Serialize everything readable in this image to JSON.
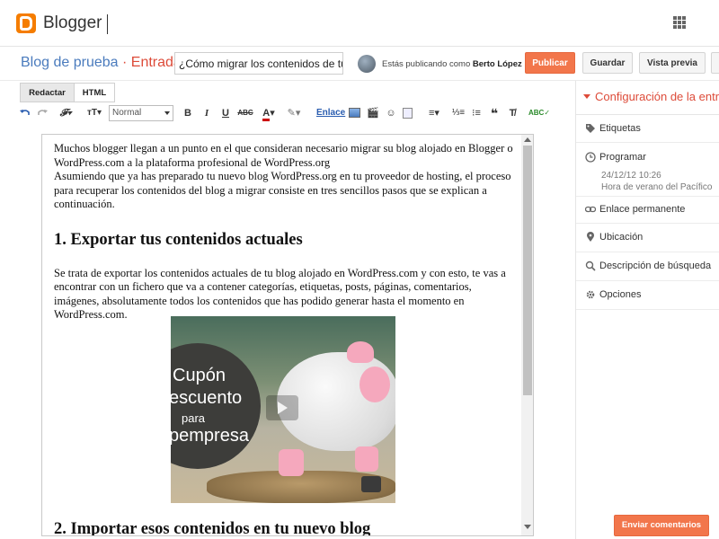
{
  "app": {
    "name": "Blogger"
  },
  "header": {
    "blog_name": "Blog de prueba",
    "separator": "·",
    "entry_label": "Entrada",
    "post_title": "¿Cómo migrar los contenidos de tu blog",
    "publishing_prefix": "Estás publicando como",
    "publishing_user": "Berto López",
    "publish_label": "Publicar",
    "save_label": "Guardar",
    "preview_label": "Vista previa"
  },
  "editor": {
    "tabs": [
      "Redactar",
      "HTML"
    ],
    "font_size": "Normal",
    "link_label": "Enlace",
    "paragraphs": [
      "Muchos blogger llegan a un punto en el que consideran necesario migrar su blog alojado en Blogger o WordPress.com a la plataforma profesional de WordPress.org",
      "Asumiendo que ya has preparado tu nuevo blog WordPress.org en tu proveedor de hosting, el proceso para recuperar los contenidos del blog a migrar consiste en tres sencillos pasos que se explican a continuación.",
      "Se trata de exportar los contenidos actuales de tu blog alojado en WordPress.com y con esto, te vas a encontrar con un fichero que va a contener categorías, etiquetas, posts, páginas, comentarios, imágenes, absolutamente todos los contenidos que has podido generar hasta el momento en WordPress.com."
    ],
    "headings": [
      "1. Exportar tus contenidos actuales",
      "2. Importar esos contenidos en tu nuevo blog"
    ],
    "video_text": [
      "Cupón",
      "escuento",
      "para",
      "pempresa"
    ]
  },
  "sidebar": {
    "title": "Configuración de la entrada",
    "items": [
      {
        "label": "Etiquetas",
        "icon": "tag-icon"
      },
      {
        "label": "Programar",
        "icon": "clock-icon",
        "sub": [
          "24/12/12 10:26",
          "Hora de verano del Pacífico"
        ]
      },
      {
        "label": "Enlace permanente",
        "icon": "link-icon"
      },
      {
        "label": "Ubicación",
        "icon": "location-icon"
      },
      {
        "label": "Descripción de búsqueda",
        "icon": "search-icon"
      },
      {
        "label": "Opciones",
        "icon": "gear-icon"
      }
    ]
  },
  "feedback_label": "Enviar comentarios",
  "colors": {
    "accent": "#f2764b",
    "brand": "#f57d00",
    "blog_link": "#4a7bbd",
    "entry": "#dd4b39"
  }
}
